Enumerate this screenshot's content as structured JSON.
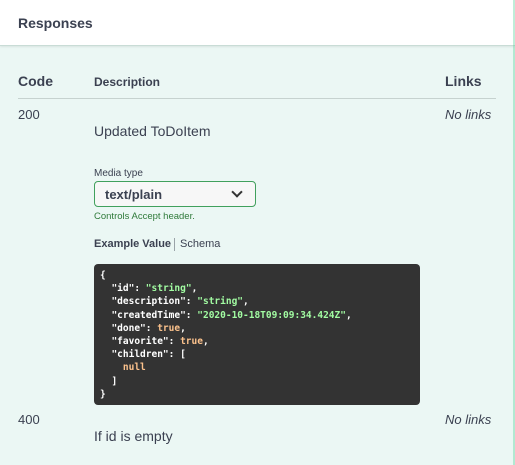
{
  "header": {
    "title": "Responses"
  },
  "table": {
    "columns": {
      "code": "Code",
      "description": "Description",
      "links": "Links"
    }
  },
  "responses": [
    {
      "code": "200",
      "description": "Updated ToDoItem",
      "links": "No links",
      "media_type": {
        "label": "Media type",
        "selected": "text/plain",
        "controls_text": "Controls Accept header."
      },
      "tabs": {
        "example": "Example Value",
        "schema": "Schema"
      },
      "example": {
        "id": "string",
        "description": "string",
        "createdTime": "2020-10-18T09:09:34.424Z",
        "done": "true",
        "favorite": "true",
        "children_item": "null"
      }
    },
    {
      "code": "400",
      "description": "If id is empty",
      "links": "No links"
    }
  ],
  "colors": {
    "background": "#ebf7f4",
    "accent_green": "#49cc90",
    "select_border": "#41a05d",
    "code_bg": "#333333",
    "code_string": "#a2fca2",
    "code_literal": "#fcc28c"
  },
  "icons": {
    "select_arrow": "chevron-down-icon"
  }
}
